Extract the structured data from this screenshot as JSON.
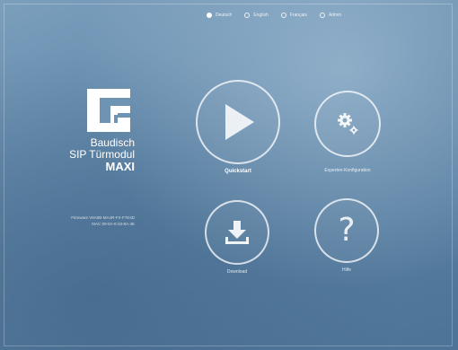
{
  "languages": [
    {
      "label": "Deutsch",
      "selected": true
    },
    {
      "label": "English",
      "selected": false
    },
    {
      "label": "Français",
      "selected": false
    },
    {
      "label": "Admin",
      "selected": false
    }
  ],
  "brand": {
    "line1": "Baudisch",
    "line2": "SIP Türmodul",
    "line3": "MAXI"
  },
  "firmware": {
    "line1": "Firmware V6A0B-MA4R-FX-F7E4D",
    "line2": "MAC 00-0A-0-33-8A-4E"
  },
  "tiles": {
    "quickstart": {
      "label": "Quickstart",
      "icon": "play-icon"
    },
    "config": {
      "label": "Experten-Konfiguration",
      "icon": "gears-icon"
    },
    "download": {
      "label": "Download",
      "icon": "download-icon"
    },
    "help": {
      "label": "Hilfe",
      "icon": "question-icon",
      "glyph": "?"
    }
  },
  "colors": {
    "background": "#5d84a6",
    "accent": "#ffffff"
  }
}
